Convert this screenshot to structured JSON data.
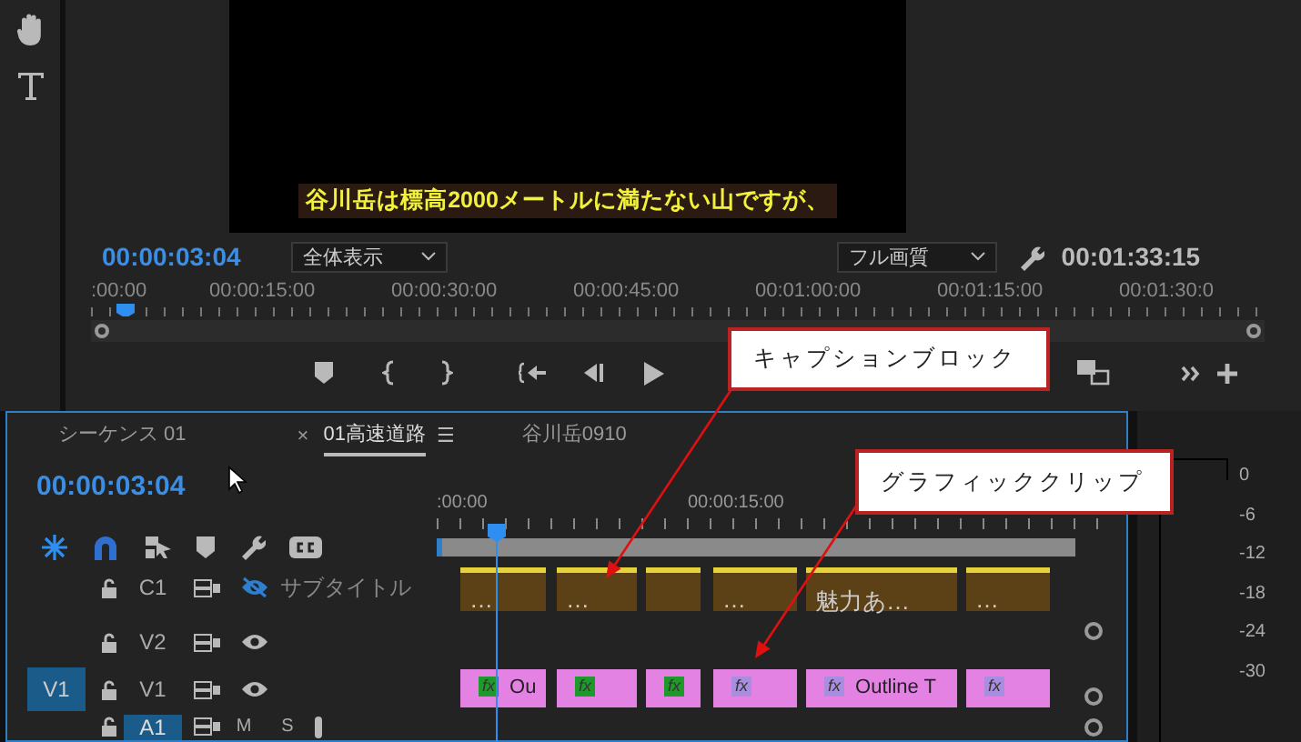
{
  "program_monitor": {
    "caption": "谷川岳は標高2000メートルに満たない山ですが、",
    "timecode": "00:00:03:04",
    "zoom": "全体表示",
    "quality": "フル画質",
    "duration": "00:01:33:15",
    "ruler_labels": [
      ":00:00",
      "00:00:15:00",
      "00:00:30:00",
      "00:00:45:00",
      "00:01:00:00",
      "00:01:15:00",
      "00:01:30:0"
    ]
  },
  "timeline": {
    "tabs": [
      {
        "label": "シーケンス 01",
        "selected": false
      },
      {
        "label": "01高速道路",
        "selected": true,
        "close": "×",
        "menu": "☰"
      },
      {
        "label": "谷川岳0910",
        "selected": false
      }
    ],
    "timecode": "00:00:03:04",
    "ruler_labels": [
      ":00:00",
      "00:00:15:00"
    ],
    "tracks": [
      {
        "kind": "caption",
        "name": "C1",
        "targeted": false,
        "visible": false,
        "label": "サブタイトル"
      },
      {
        "kind": "video",
        "name": "V2",
        "targeted": false,
        "visible": true
      },
      {
        "kind": "video",
        "name": "V1",
        "source": "V1",
        "targeted": false,
        "visible": true
      },
      {
        "kind": "audio",
        "name": "A1",
        "targeted": true,
        "buttons": [
          "M",
          "S"
        ]
      }
    ],
    "caption_clips": [
      {
        "kind": "text",
        "text": "…"
      },
      {
        "kind": "text",
        "text": "…"
      },
      {
        "kind": "blank"
      },
      {
        "kind": "text",
        "text": "…"
      },
      {
        "kind": "text",
        "text": "魅力あ…"
      },
      {
        "kind": "text",
        "text": "…"
      }
    ],
    "graphic_clips": [
      {
        "badge": "fx",
        "color": "#1f9a2a",
        "text": "Ou"
      },
      {
        "badge": "fx",
        "color": "#1f9a2a"
      },
      {
        "badge": "fx",
        "color": "#1f9a2a"
      },
      {
        "badge": "fx",
        "color": "#a98ee0"
      },
      {
        "badge": "fx",
        "color": "#a98ee0",
        "text": "Outline T"
      },
      {
        "badge": "fx",
        "color": "#a98ee0"
      }
    ]
  },
  "audio_meter": {
    "scale": [
      "0",
      "-6",
      "-12",
      "-18",
      "-24",
      "-30"
    ]
  },
  "callouts": [
    {
      "text": "キャプションブロック"
    },
    {
      "text": "グラフィッククリップ"
    }
  ]
}
